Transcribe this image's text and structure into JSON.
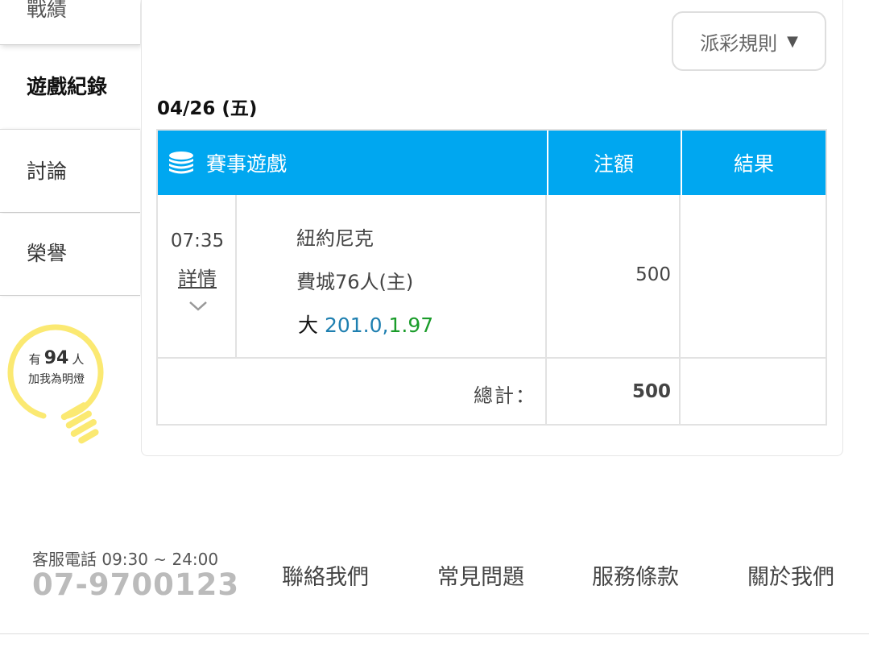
{
  "sidebar": {
    "tab_record": "戰績",
    "tab_game_log": "遊戲紀錄",
    "tab_discuss": "討論",
    "tab_honor": "榮譽"
  },
  "lightbulb": {
    "prefix": "有",
    "count": "94",
    "suffix": "人",
    "caption": "加我為明燈",
    "color": "#fbe972"
  },
  "rules_button": {
    "label": "派彩規則",
    "arrow": "▼"
  },
  "date": "04/26 (五)",
  "table": {
    "header": {
      "game": "賽事遊戲",
      "bet": "注額",
      "result": "結果",
      "color": "#00a7f0"
    },
    "row": {
      "time": "07:35",
      "detail_link": "詳情",
      "team_away": "紐約尼克",
      "team_home": "費城76人(主)",
      "pick_side": "大",
      "pick_line": "201.0,",
      "pick_odds": "1.97",
      "bet": "500",
      "result": ""
    },
    "total": {
      "label": "總計：",
      "amount": "500"
    }
  },
  "footer": {
    "service_label": "客服電話 09:30 ~ 24:00",
    "phone": "07-9700123",
    "links": [
      "聯絡我們",
      "常見問題",
      "服務條款",
      "關於我們"
    ]
  }
}
